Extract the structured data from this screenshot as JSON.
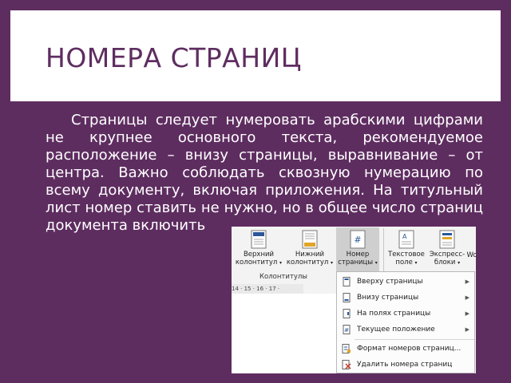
{
  "slide": {
    "title": "НОМЕРА СТРАНИЦ",
    "body": "Страницы следует нумеровать арабскими цифрами не крупнее основного текста, рекомендуемое расположение – внизу страницы, выравнивание – от центра. Важно соблюдать сквозную нумерацию по всему документу, включая приложения. На титульный лист номер ставить не нужно, но в общее число страниц документа включить"
  },
  "ribbon": {
    "header_button": {
      "line1": "Верхний",
      "line2": "колонтитул",
      "icon": "header-icon"
    },
    "footer_button": {
      "line1": "Нижний",
      "line2": "колонтитул",
      "icon": "footer-icon"
    },
    "page_number_button": {
      "line1": "Номер",
      "line2": "страницы",
      "icon": "page-number-icon"
    },
    "textbox_button": {
      "line1": "Текстовое",
      "line2": "поле",
      "icon": "textbox-icon"
    },
    "quickparts_button": {
      "line1": "Экспресс-",
      "line2": "блоки",
      "icon": "quickparts-icon"
    },
    "partial_button": "Wo",
    "group_label": "Колонтитулы",
    "caret": "▾"
  },
  "ruler": {
    "text": "14 · 15 · 16 · 17 ·"
  },
  "menu": {
    "items": [
      {
        "label": "Вверху страницы",
        "has_submenu": true,
        "icon": "page-top-icon"
      },
      {
        "label": "Внизу страницы",
        "has_submenu": true,
        "icon": "page-bottom-icon"
      },
      {
        "label": "На полях страницы",
        "has_submenu": true,
        "icon": "page-margin-icon"
      },
      {
        "label": "Текущее положение",
        "has_submenu": true,
        "icon": "current-position-icon"
      },
      {
        "label": "Формат номеров страниц...",
        "has_submenu": false,
        "icon": "format-numbers-icon"
      },
      {
        "label": "Удалить номера страниц",
        "has_submenu": false,
        "icon": "remove-numbers-icon"
      }
    ],
    "submenu_arrow": "▶"
  },
  "colors": {
    "slide_bg": "#5e2d60",
    "title_color": "#5e2d60",
    "accent_blue": "#2b579a",
    "delete_red": "#c0392b"
  }
}
